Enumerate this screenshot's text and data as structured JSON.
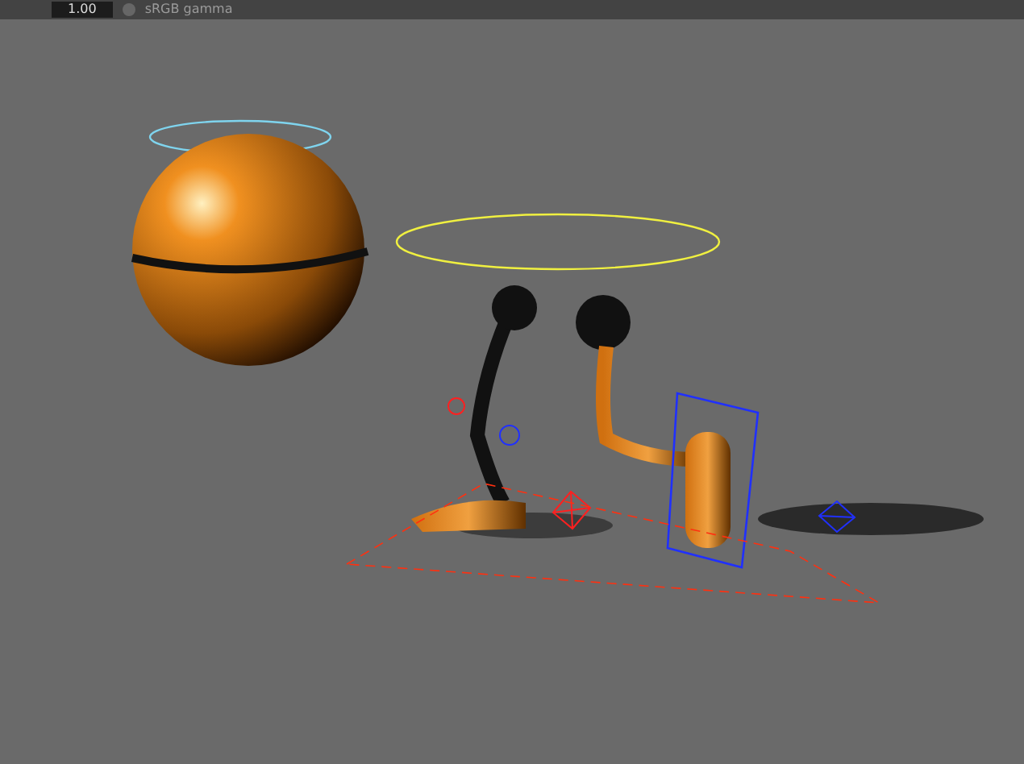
{
  "toolbar": {
    "value": "1.00",
    "label": "sRGB gamma"
  }
}
